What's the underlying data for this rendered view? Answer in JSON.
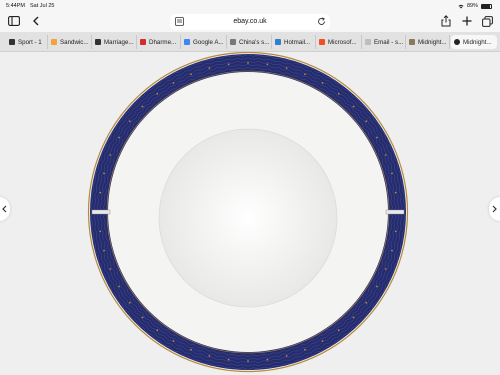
{
  "status": {
    "time": "5:44PM",
    "date": "Sat Jul 25",
    "battery": "89%",
    "battery_level": 0.89
  },
  "toolbar": {
    "url": "ebay.co.uk"
  },
  "tabs": [
    {
      "label": "Sport - 1",
      "icon": "sport-favicon",
      "color": "#333333"
    },
    {
      "label": "Sandwic...",
      "icon": "sandwich-favicon",
      "color": "#f2a33a"
    },
    {
      "label": "Marriage...",
      "icon": "marriage-favicon",
      "color": "#333333"
    },
    {
      "label": "Dharme...",
      "icon": "dharme-favicon",
      "color": "#d22d2d"
    },
    {
      "label": "Google A...",
      "icon": "google-favicon",
      "color": "#4285f4"
    },
    {
      "label": "China's s...",
      "icon": "china-favicon",
      "color": "#777777"
    },
    {
      "label": "Hotmail...",
      "icon": "hotmail-favicon",
      "color": "#2f7fd0"
    },
    {
      "label": "Microsof...",
      "icon": "microsoft-favicon",
      "color": "#f25022"
    },
    {
      "label": "Email - s...",
      "icon": "email-favicon",
      "color": "#bdbdbd"
    },
    {
      "label": "Midnight...",
      "icon": "midnight-favicon",
      "color": "#8a7a5a"
    },
    {
      "label": "Midnight...",
      "icon": "close-icon",
      "color": "#222222"
    }
  ],
  "colors": {
    "rim": "#252c6e",
    "gold": "#b48a3c",
    "plate": "#f4f4f2"
  }
}
